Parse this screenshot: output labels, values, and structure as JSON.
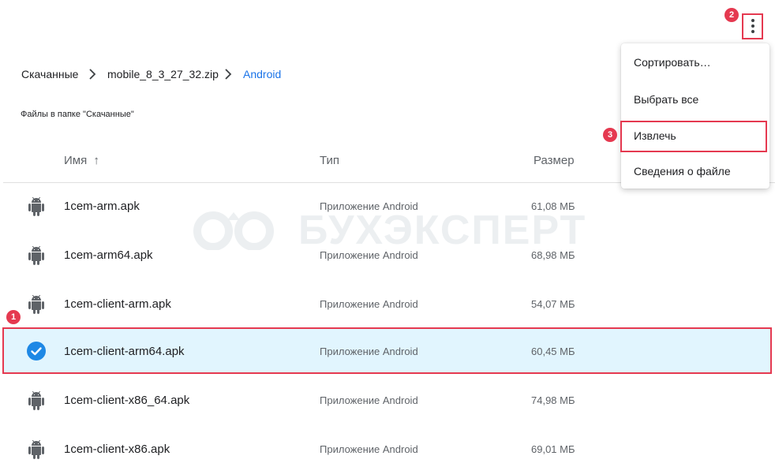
{
  "breadcrumb": {
    "items": [
      "Скачанные",
      "mobile_8_3_27_32.zip",
      "Android"
    ]
  },
  "section_title": "Файлы в папке \"Скачанные\"",
  "columns": {
    "name": "Имя",
    "sort_indicator": "↑",
    "type": "Тип",
    "size": "Размер"
  },
  "files": [
    {
      "name": "1cem-arm.apk",
      "type": "Приложение Android",
      "size": "61,08 МБ",
      "selected": false
    },
    {
      "name": "1cem-arm64.apk",
      "type": "Приложение Android",
      "size": "68,98 МБ",
      "selected": false
    },
    {
      "name": "1cem-client-arm.apk",
      "type": "Приложение Android",
      "size": "54,07 МБ",
      "selected": false
    },
    {
      "name": "1cem-client-arm64.apk",
      "type": "Приложение Android",
      "size": "60,45 МБ",
      "selected": true
    },
    {
      "name": "1cem-client-x86_64.apk",
      "type": "Приложение Android",
      "size": "74,98 МБ",
      "selected": false
    },
    {
      "name": "1cem-client-x86.apk",
      "type": "Приложение Android",
      "size": "69,01 МБ",
      "selected": false
    }
  ],
  "menu": {
    "items": [
      "Сортировать…",
      "Выбрать все",
      "Извлечь",
      "Сведения о файле"
    ]
  },
  "annotations": {
    "badge_1": "1",
    "badge_2": "2",
    "badge_3": "3"
  },
  "watermark": "БУХЭКСПЕРТ",
  "colors": {
    "accent": "#1a73e8",
    "highlight": "#e53950",
    "selected_row": "#e1f5fe",
    "check": "#1e88e5",
    "android_icon": "#5f6368"
  },
  "icons": {
    "file_icon": "android-icon",
    "selected_icon": "check-circle-icon",
    "more_icon": "more-vert-icon",
    "breadcrumb_separator": "chevron-right-icon"
  }
}
